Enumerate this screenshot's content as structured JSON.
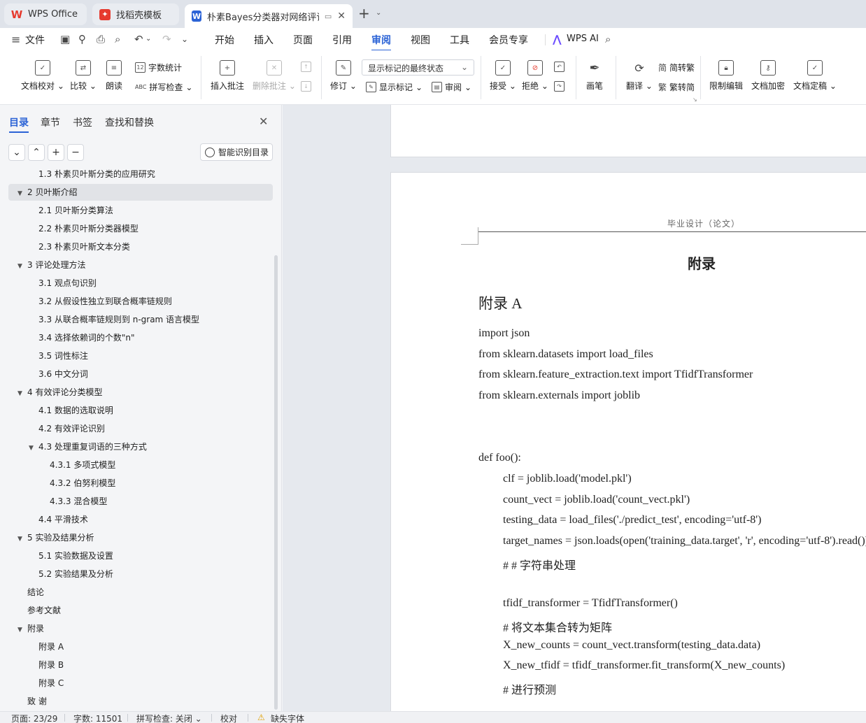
{
  "tabs": [
    {
      "label": "WPS Office",
      "icon": "wps-logo-icon"
    },
    {
      "label": "找稻壳模板",
      "icon": "docer-logo-icon"
    },
    {
      "label": "朴素Bayes分类器对网络评论有",
      "icon": "wps-writer-icon",
      "active": true
    }
  ],
  "menu": {
    "file": "文件",
    "items": [
      "开始",
      "插入",
      "页面",
      "引用",
      "审阅",
      "视图",
      "工具",
      "会员专享"
    ],
    "active": "审阅",
    "wps_ai": "WPS AI"
  },
  "ribbon": {
    "proofread": "文档校对",
    "compare": "比较",
    "read_aloud": "朗读",
    "word_count": "字数统计",
    "spell_check": "拼写检查",
    "insert_comment": "插入批注",
    "delete_comment": "删除批注",
    "track_changes": "修订",
    "markup_mode": "显示标记的最终状态",
    "show_markup": "显示标记",
    "review": "审阅",
    "accept": "接受",
    "reject": "拒绝",
    "pen": "画笔",
    "translate": "翻译",
    "to_traditional": "简转繁",
    "to_simplified": "繁转简",
    "restrict_edit": "限制编辑",
    "encrypt": "文档加密",
    "finalize": "文档定稿"
  },
  "nav": {
    "tabs": [
      "目录",
      "章节",
      "书签",
      "查找和替换"
    ],
    "active_tab": "目录",
    "smart_toc": "智能识别目录",
    "toc": [
      {
        "label": "1.3 朴素贝叶斯分类的应用研究",
        "level": 2
      },
      {
        "label": "2  贝叶斯介绍",
        "level": 1,
        "expanded": true,
        "selected": true
      },
      {
        "label": "2.1 贝叶斯分类算法",
        "level": 2
      },
      {
        "label": "2.2 朴素贝叶斯分类器模型",
        "level": 2
      },
      {
        "label": "2.3 朴素贝叶斯文本分类",
        "level": 2
      },
      {
        "label": "3  评论处理方法",
        "level": 1,
        "expanded": true
      },
      {
        "label": "3.1 观点句识别",
        "level": 2
      },
      {
        "label": "3.2 从假设性独立到联合概率链规则",
        "level": 2
      },
      {
        "label": "3.3 从联合概率链规则到 n-gram 语言模型",
        "level": 2
      },
      {
        "label": "3.4 选择依赖词的个数\"n\"",
        "level": 2
      },
      {
        "label": "3.5 词性标注",
        "level": 2
      },
      {
        "label": "3.6 中文分词",
        "level": 2
      },
      {
        "label": "4  有效评论分类模型",
        "level": 1,
        "expanded": true
      },
      {
        "label": "4.1 数据的选取说明",
        "level": 2
      },
      {
        "label": "4.2 有效评论识别",
        "level": 2
      },
      {
        "label": "4.3 处理重复词语的三种方式",
        "level": 2,
        "expanded": true
      },
      {
        "label": "4.3.1 多项式模型",
        "level": 3
      },
      {
        "label": "4.3.2 伯努利模型",
        "level": 3
      },
      {
        "label": "4.3.3 混合模型",
        "level": 3
      },
      {
        "label": "4.4 平滑技术",
        "level": 2
      },
      {
        "label": "5  实验及结果分析",
        "level": 1,
        "expanded": true
      },
      {
        "label": "5.1 实验数据及设置",
        "level": 2
      },
      {
        "label": "5.2 实验结果及分析",
        "level": 2
      },
      {
        "label": "结论",
        "level": 1
      },
      {
        "label": "参考文献",
        "level": 1
      },
      {
        "label": "附录",
        "level": 1,
        "expanded": true
      },
      {
        "label": "附录 A",
        "level": 2
      },
      {
        "label": "附录 B",
        "level": 2
      },
      {
        "label": "附录 C",
        "level": 2
      },
      {
        "label": "致  谢",
        "level": 1
      }
    ]
  },
  "document": {
    "header": "毕业设计（论文）",
    "title": "附录",
    "subtitle": "附录 A",
    "code_lines": [
      {
        "text": "import json",
        "indent": 0
      },
      {
        "text": "from sklearn.datasets import load_files",
        "indent": 0
      },
      {
        "text": "from sklearn.feature_extraction.text import TfidfTransformer",
        "indent": 0
      },
      {
        "text": "from sklearn.externals import joblib",
        "indent": 0
      },
      {
        "text": "",
        "indent": 0
      },
      {
        "text": "",
        "indent": 0
      },
      {
        "text": "def foo():",
        "indent": 0
      },
      {
        "text": "clf = joblib.load('model.pkl')",
        "indent": 1
      },
      {
        "text": "count_vect = joblib.load('count_vect.pkl')",
        "indent": 1
      },
      {
        "text": "testing_data = load_files('./predict_test', encoding='utf-8')",
        "indent": 1
      },
      {
        "text": "target_names = json.loads(open('training_data.target', 'r', encoding='utf-8').read())",
        "indent": 1
      },
      {
        "text": "#         #  字符串处理",
        "indent": 1
      },
      {
        "text": "",
        "indent": 1
      },
      {
        "text": "tfidf_transformer = TfidfTransformer()",
        "indent": 1
      },
      {
        "text": "#  将文本集合转为矩阵",
        "indent": 1
      },
      {
        "text": "X_new_counts = count_vect.transform(testing_data.data)",
        "indent": 1
      },
      {
        "text": "X_new_tfidf = tfidf_transformer.fit_transform(X_new_counts)",
        "indent": 1
      },
      {
        "text": "#  进行预测",
        "indent": 1
      }
    ]
  },
  "status": {
    "page": "页面: 23/29",
    "word_count": "字数: 11501",
    "spell_check": "拼写检查: 关闭",
    "proofread": "校对",
    "missing_font": "缺失字体"
  },
  "colors": {
    "accent": "#2b63d6",
    "wps_red": "#e63a2e"
  }
}
